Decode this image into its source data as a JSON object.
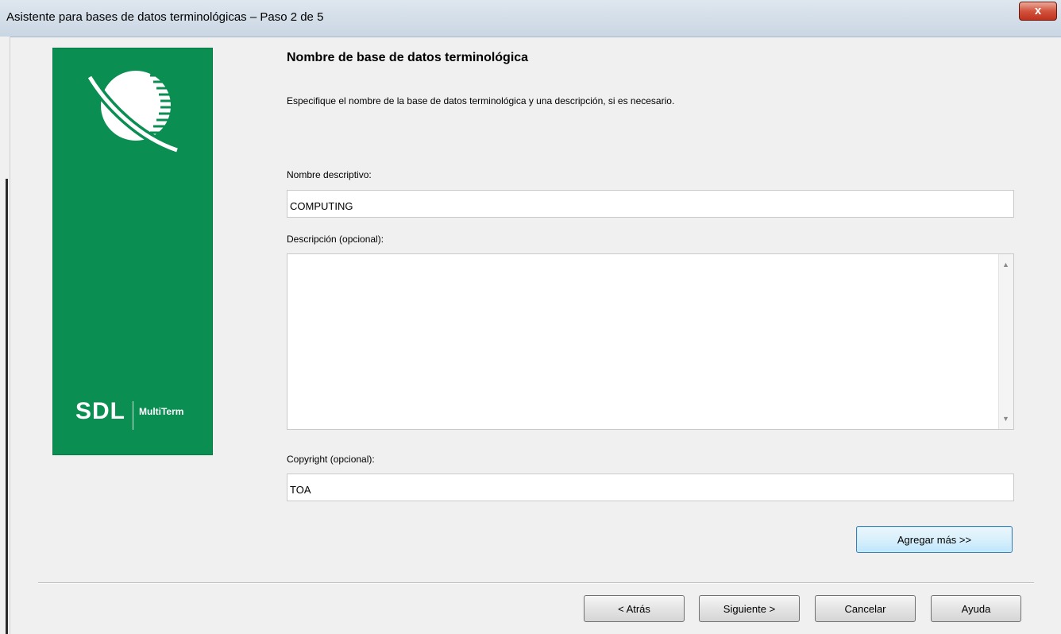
{
  "window": {
    "title": "Asistente para bases de datos terminológicas – Paso 2 de 5",
    "close_glyph": "x"
  },
  "branding": {
    "sdl": "SDL",
    "product": "MultiTerm",
    "panel_color": "#0a8e52"
  },
  "page": {
    "heading": "Nombre de base de datos terminológica",
    "instruction": "Especifique el nombre de la base de datos terminológica y una descripción, si es necesario."
  },
  "form": {
    "name_label": "Nombre descriptivo:",
    "name_value": "COMPUTING",
    "description_label": "Descripción (opcional):",
    "description_value": "",
    "copyright_label": "Copyright (opcional):",
    "copyright_value": "TOA",
    "add_more_label": "Agregar más >>"
  },
  "footer": {
    "back_label": "< Atrás",
    "next_label": "Siguiente >",
    "cancel_label": "Cancelar",
    "help_label": "Ayuda"
  },
  "icons": {
    "close": "close-icon",
    "logo": "sdl-globe-logo-icon",
    "scroll_up": "scroll-up-arrow-icon",
    "scroll_down": "scroll-down-arrow-icon"
  }
}
